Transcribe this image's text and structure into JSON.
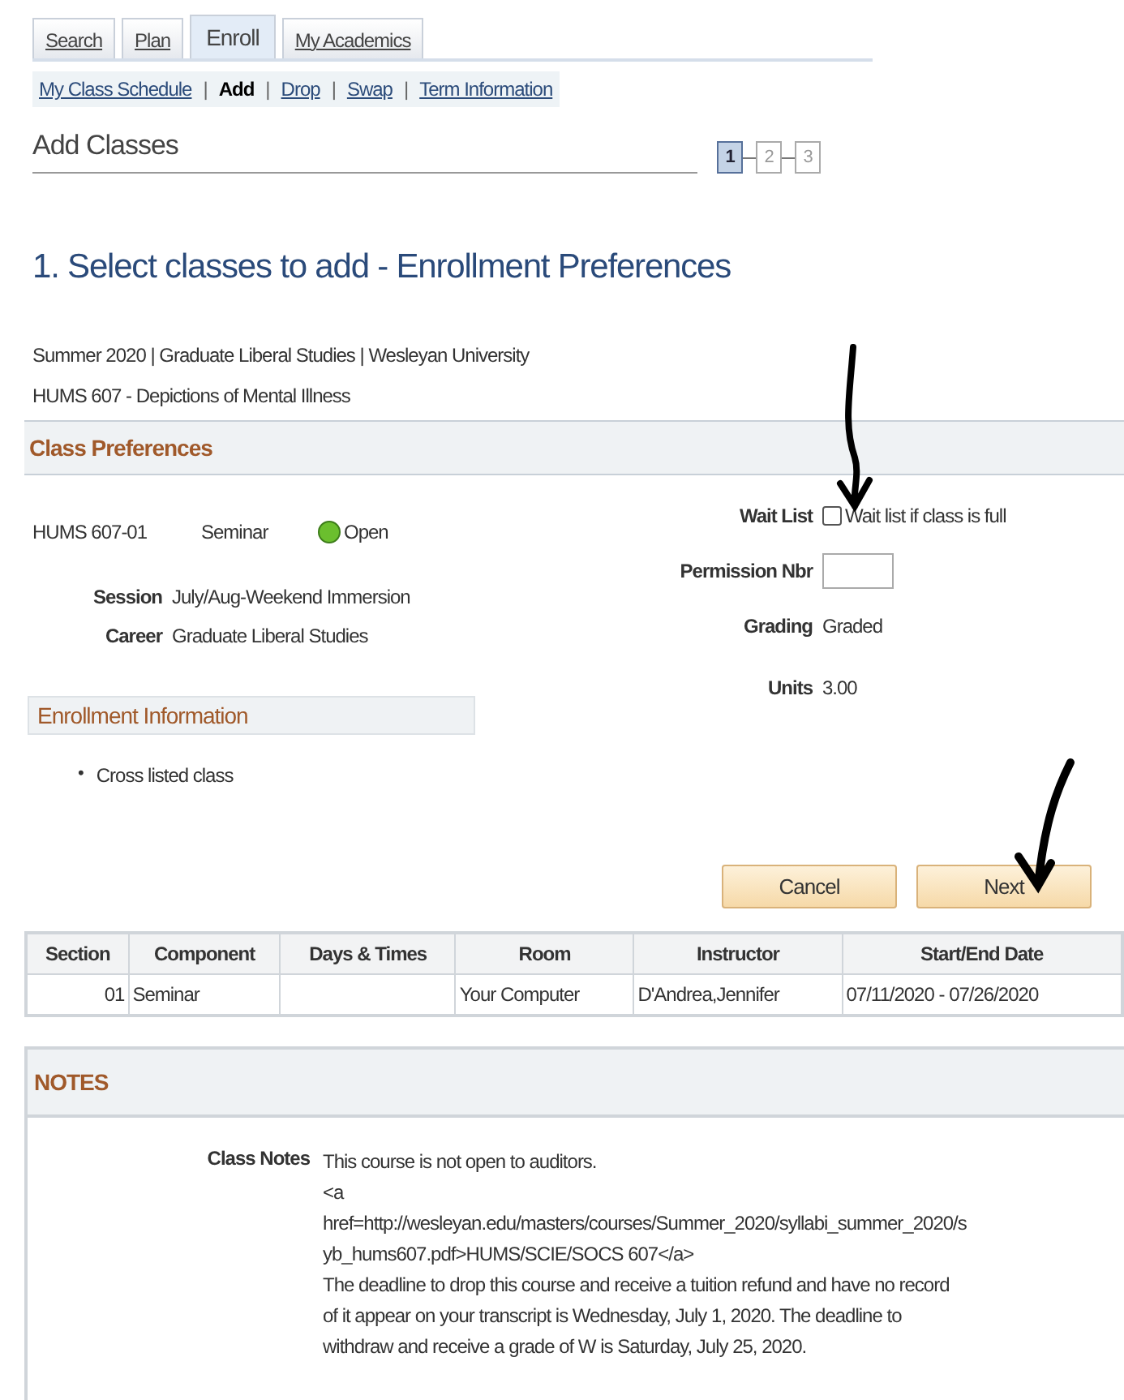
{
  "tabs": [
    {
      "label": "Search",
      "selected": false
    },
    {
      "label": "Plan",
      "selected": false
    },
    {
      "label": "Enroll",
      "selected": true
    },
    {
      "label": "My Academics",
      "selected": false
    }
  ],
  "subnav_separator": "|",
  "subnav": [
    {
      "label": "My Class Schedule",
      "selected": false
    },
    {
      "label": "Add",
      "selected": true
    },
    {
      "label": "Drop",
      "selected": false
    },
    {
      "label": "Swap",
      "selected": false
    },
    {
      "label": "Term Information",
      "selected": false
    }
  ],
  "page_title": "Add Classes",
  "steps": [
    {
      "label": "1",
      "selected": true
    },
    {
      "label": "2",
      "selected": false
    },
    {
      "label": "3",
      "selected": false
    }
  ],
  "heading": "1.  Select classes to add - Enrollment Preferences",
  "term_line": "Summer 2020 | Graduate Liberal Studies | Wesleyan University",
  "course_line": "HUMS  607 - Depictions of Mental Illness",
  "class_preferences": {
    "title": "Class Preferences",
    "class_number": "HUMS  607-01",
    "component": "Seminar",
    "status": {
      "label": "Open",
      "color": "#6bbf2e"
    },
    "fields": [
      {
        "label": "Session",
        "value": "July/Aug-Weekend Immersion"
      },
      {
        "label": "Career",
        "value": "Graduate Liberal Studies"
      }
    ],
    "wait_list": {
      "label": "Wait List",
      "option": "Wait list if class is full",
      "checked": false
    },
    "permission": {
      "label": "Permission Nbr"
    },
    "grading": {
      "label": "Grading",
      "value": "Graded"
    },
    "units": {
      "label": "Units",
      "value": "3.00"
    }
  },
  "enrollment_information": {
    "title": "Enrollment Information",
    "items": [
      {
        "bullet": "•",
        "text": "Cross listed class"
      }
    ]
  },
  "buttons": [
    "Cancel",
    "Next"
  ],
  "table": {
    "columns": [
      "Section",
      "Component",
      "Days & Times",
      "Room",
      "Instructor",
      "Start/End Date"
    ],
    "rows": [
      [
        "01",
        "Seminar",
        "",
        "Your Computer",
        "D'Andrea,Jennifer",
        "07/11/2020 - 07/26/2020"
      ]
    ]
  },
  "notes": {
    "title": "NOTES",
    "label": "Class Notes",
    "lines": [
      "This course is not open to auditors.",
      "<a",
      "href=http://wesleyan.edu/masters/courses/Summer_2020/syllabi_summer_2020/s",
      "yb_hums607.pdf>HUMS/SCIE/SOCS 607</a>",
      "The deadline to drop this course and receive a tuition refund and have no record",
      "of it appear on your transcript is Wednesday, July 1, 2020. The deadline to",
      "withdraw and receive a grade of W is Saturday, July 25, 2020."
    ]
  }
}
